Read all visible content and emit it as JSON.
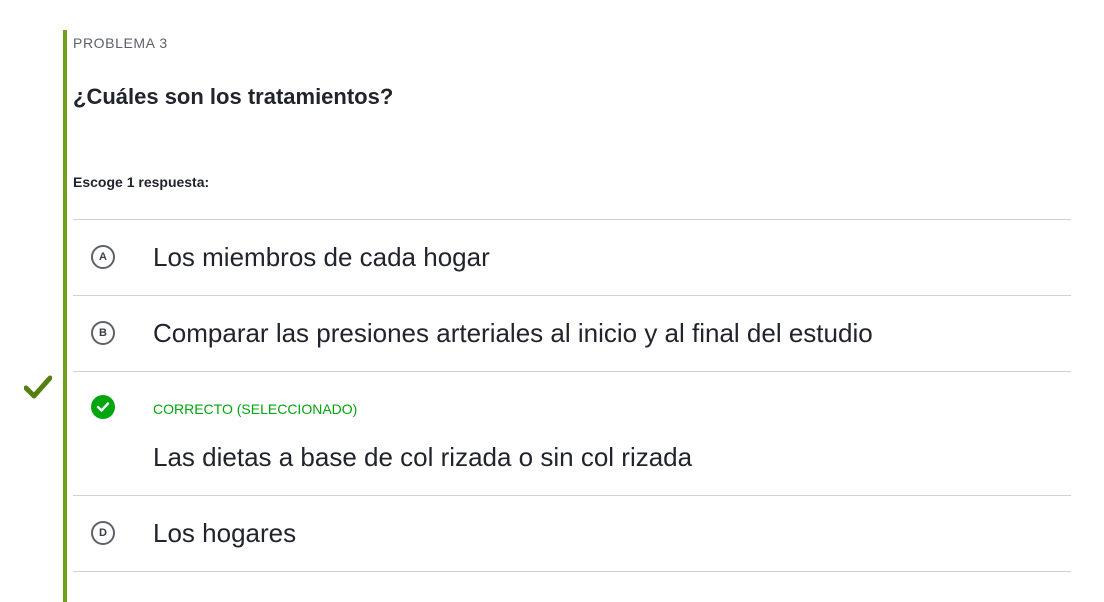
{
  "problem": {
    "label": "PROBLEMA 3",
    "question": "¿Cuáles son los tratamientos?",
    "instruction": "Escoge 1 respuesta:"
  },
  "choices": [
    {
      "letter": "A",
      "text": "Los miembros de cada hogar",
      "state": "unselected"
    },
    {
      "letter": "B",
      "text": "Comparar las presiones arteriales al inicio y al final del estudio",
      "state": "unselected"
    },
    {
      "letter": "C",
      "text": "Las dietas a base de col rizada o sin col rizada",
      "state": "correct-selected",
      "status_label": "CORRECTO (SELECCIONADO)"
    },
    {
      "letter": "D",
      "text": "Los hogares",
      "state": "unselected"
    }
  ],
  "icons": {
    "side_marker": "checkmark-icon",
    "correct_badge": "check-circle-icon"
  },
  "colors": {
    "accent_bar": "#72a01e",
    "correct": "#00a60e",
    "text": "#21242c",
    "muted": "#5d6169",
    "divider": "#cfd0d2"
  }
}
